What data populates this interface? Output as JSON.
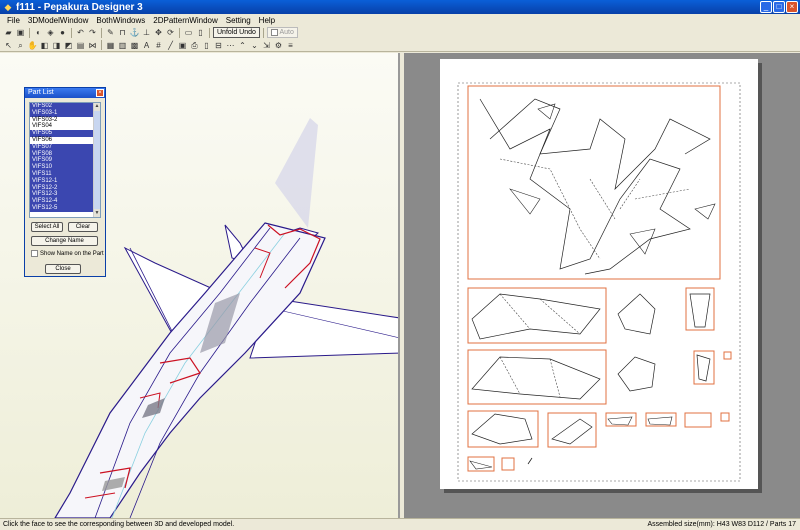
{
  "window": {
    "title": "f111 - Pepakura Designer 3",
    "app_icon": "pepakura-icon"
  },
  "menu": [
    "File",
    "3DModelWindow",
    "BothWindows",
    "2DPatternWindow",
    "Setting",
    "Help"
  ],
  "toolbar": {
    "unfold_undo": "Unfold Undo",
    "auto": "Auto"
  },
  "part_list": {
    "title": "Part List",
    "items": [
      {
        "label": "VIFS02",
        "selected": true
      },
      {
        "label": "VIFS03-1",
        "selected": true
      },
      {
        "label": "VIFS03-2",
        "selected": false
      },
      {
        "label": "VIFS04",
        "selected": false
      },
      {
        "label": "VIFS05",
        "selected": true
      },
      {
        "label": "VIFS06",
        "selected": false
      },
      {
        "label": "VIFS07",
        "selected": true
      },
      {
        "label": "VIFS08",
        "selected": true
      },
      {
        "label": "VIFS09",
        "selected": true
      },
      {
        "label": "VIFS10",
        "selected": true
      },
      {
        "label": "VIFS11",
        "selected": true
      },
      {
        "label": "VIFS12-1",
        "selected": true
      },
      {
        "label": "VIFS12-2",
        "selected": true
      },
      {
        "label": "VIFS12-3",
        "selected": true
      },
      {
        "label": "VIFS12-4",
        "selected": true
      },
      {
        "label": "VIFS12-5",
        "selected": true
      }
    ],
    "select_all": "Select All",
    "clear": "Clear",
    "change_name": "Change Name",
    "show_name": "Show Name on the Part",
    "close": "Close"
  },
  "status": {
    "hint": "Click the face to see the corresponding between 3D and developed model.",
    "info": "Assembled size(mm): H43 W83 D112 / Parts 17"
  },
  "colors": {
    "selection": "#3b47b0",
    "outline": "#e07040",
    "model_edge": "#2a1a8a",
    "model_seam": "#cc1122"
  }
}
